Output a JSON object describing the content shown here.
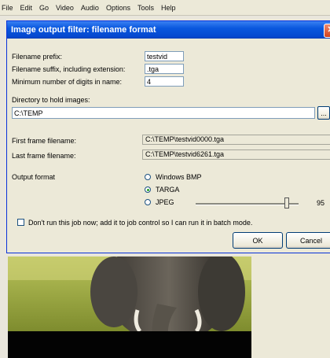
{
  "menubar": {
    "items": [
      "File",
      "Edit",
      "Go",
      "Video",
      "Audio",
      "Options",
      "Tools",
      "Help"
    ]
  },
  "dialog": {
    "title": "Image output filter: filename format",
    "close_glyph": "✕",
    "prefix_label": "Filename prefix:",
    "prefix_value": "testvid",
    "suffix_label": "Filename suffix, including extension:",
    "suffix_value": ".tga",
    "digits_label": "Minimum number of digits in name:",
    "digits_value": "4",
    "directory_label": "Directory to hold images:",
    "directory_value": "C:\\TEMP",
    "browse_label": "...",
    "first_frame_label": "First frame filename:",
    "first_frame_value": "C:\\TEMP\\testvid0000.tga",
    "last_frame_label": "Last frame filename:",
    "last_frame_value": "C:\\TEMP\\testvid6261.tga",
    "output_format_label": "Output format",
    "formats": [
      "Windows BMP",
      "TARGA",
      "JPEG"
    ],
    "selected_format": "TARGA",
    "jpeg_quality": 95,
    "jpeg_quality_label": "95",
    "batch_label": "Don't run this job now; add it to job control so I can run it in batch mode.",
    "batch_checked": false,
    "ok_label": "OK",
    "cancel_label": "Cancel"
  },
  "icons": {
    "close": "close-icon",
    "radio": "radio-icon"
  },
  "colors": {
    "titlebar": "#0a58de",
    "dialog_bg": "#ece9d8",
    "field_border": "#7f9db9"
  }
}
